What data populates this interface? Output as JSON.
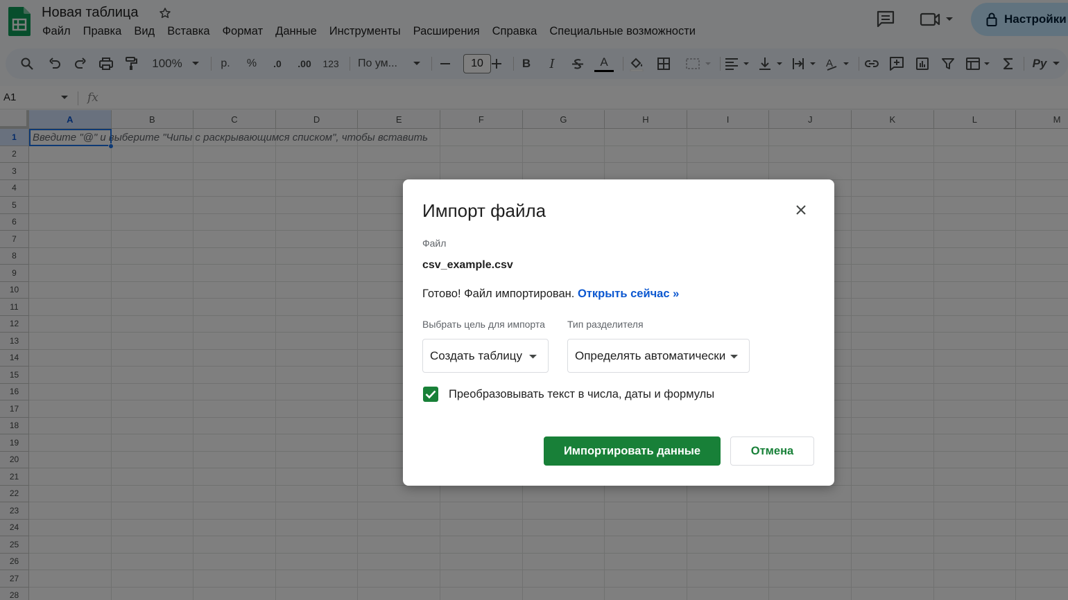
{
  "app": {
    "title": "Новая таблица",
    "share_label": "Настройки",
    "accent_color": "#188038",
    "link_color": "#0b57d0"
  },
  "menu": [
    "Файл",
    "Правка",
    "Вид",
    "Вставка",
    "Формат",
    "Данные",
    "Инструменты",
    "Расширения",
    "Справка",
    "Специальные возможности"
  ],
  "toolbar": {
    "zoom": "100%",
    "currency": "р.",
    "percent": "%",
    "decrease_decimals": ".0",
    "increase_decimals": ".00",
    "number_format": "123",
    "font_name": "По ум...",
    "font_size": "10",
    "bold": "B",
    "italic": "I",
    "text_color": "A",
    "language": "Ру",
    "icons": [
      "search-icon",
      "undo-icon",
      "redo-icon",
      "print-icon",
      "paint-format-icon",
      "minus-icon",
      "plus-icon",
      "strikethrough-icon",
      "fill-color-icon",
      "borders-icon",
      "merge-cells-icon",
      "align-left-icon",
      "vertical-align-icon",
      "text-wrap-icon",
      "text-rotation-icon",
      "link-icon",
      "comment-icon",
      "chart-icon",
      "filter-icon",
      "filter-views-icon",
      "functions-icon"
    ]
  },
  "formula_bar": {
    "cell_ref": "A1",
    "fx": "fx"
  },
  "sheet": {
    "columns": [
      "A",
      "B",
      "C",
      "D",
      "E",
      "F",
      "G",
      "H",
      "I",
      "J",
      "K",
      "L",
      "M"
    ],
    "rows": [
      "1",
      "2",
      "3",
      "4",
      "5",
      "6",
      "7",
      "8",
      "9",
      "10",
      "11",
      "12",
      "13",
      "14",
      "15",
      "16",
      "17",
      "18",
      "19",
      "20",
      "21",
      "22",
      "23",
      "24",
      "25",
      "26",
      "27",
      "28"
    ],
    "a1_hint": "Введите \"@\" и выберите \"Чипы с раскрывающимся списком\", чтобы вставить"
  },
  "dialog": {
    "title": "Импорт файла",
    "file_label": "Файл",
    "file_name": "csv_example.csv",
    "status_text": "Готово! Файл импортирован.",
    "open_link": "Открыть сейчас »",
    "target_label": "Выбрать цель для импорта",
    "target_value": "Создать таблицу",
    "separator_label": "Тип разделителя",
    "separator_value": "Определять автоматически",
    "convert_label": "Преобразовывать текст в числа, даты и формулы",
    "convert_checked": true,
    "import_button": "Импортировать данные",
    "cancel_button": "Отмена"
  }
}
